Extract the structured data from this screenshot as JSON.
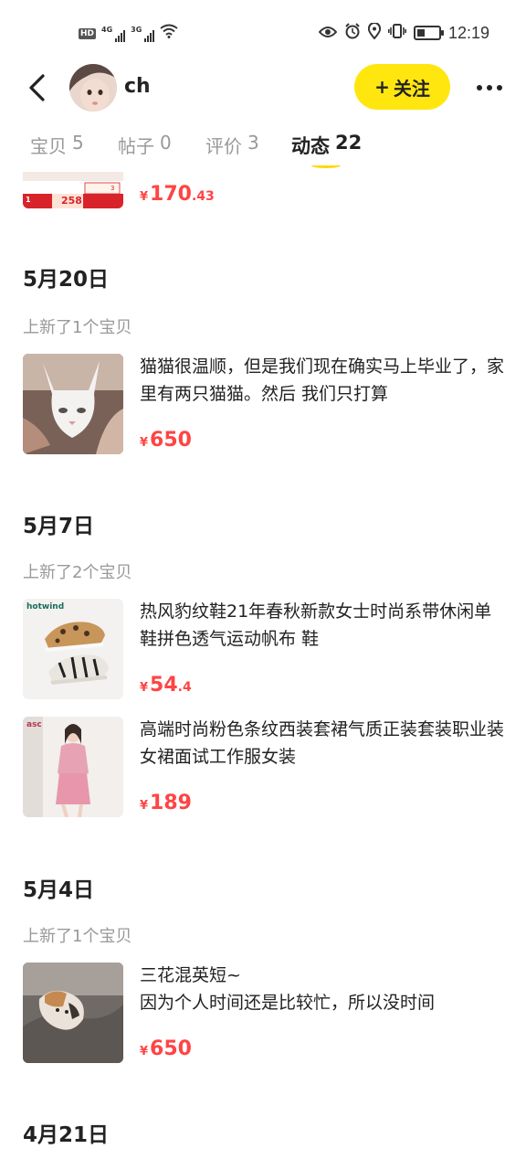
{
  "status_bar": {
    "hd": "HD",
    "sim1": "4G",
    "sim2": "3G",
    "time": "12:19"
  },
  "header": {
    "username": "ch",
    "follow_label": "关注",
    "follow_plus": "+"
  },
  "tabs": [
    {
      "label": "宝贝",
      "count": "5"
    },
    {
      "label": "帖子",
      "count": "0"
    },
    {
      "label": "评价",
      "count": "3"
    },
    {
      "label": "动态",
      "count": "22"
    }
  ],
  "feed": {
    "partial_item": {
      "price_currency": "¥",
      "price_main": "170",
      "price_decimal": ".43",
      "thumb_badge": "258",
      "thumb_tag_1": "1",
      "thumb_tag_2": "3"
    },
    "groups": [
      {
        "date": "5月20日",
        "subtitle": "上新了1个宝贝",
        "items": [
          {
            "title": "猫猫很温顺，但是我们现在确实马上毕业了，家里有两只猫猫。然后 我们只打算",
            "currency": "¥",
            "price_main": "650",
            "price_decimal": ""
          }
        ]
      },
      {
        "date": "5月7日",
        "subtitle": "上新了2个宝贝",
        "items": [
          {
            "title": "热风豹纹鞋21年春秋新款女士时尚系带休闲单鞋拼色透气运动帆布 鞋",
            "currency": "¥",
            "price_main": "54",
            "price_decimal": ".4",
            "thumb_brand": "hotwind"
          },
          {
            "title": "高端时尚粉色条纹西装套裙气质正装套装职业装女裙面试工作服女装",
            "currency": "¥",
            "price_main": "189",
            "price_decimal": "",
            "thumb_brand": "asc"
          }
        ]
      },
      {
        "date": "5月4日",
        "subtitle": "上新了1个宝贝",
        "items": [
          {
            "title": "三花混英短~\n因为个人时间还是比较忙，所以没时间",
            "currency": "¥",
            "price_main": "650",
            "price_decimal": ""
          }
        ]
      },
      {
        "date": "4月21日"
      }
    ]
  },
  "colors": {
    "accent_yellow": "#ffe60f",
    "price_red": "#ff4444",
    "muted_gray": "#999999"
  }
}
